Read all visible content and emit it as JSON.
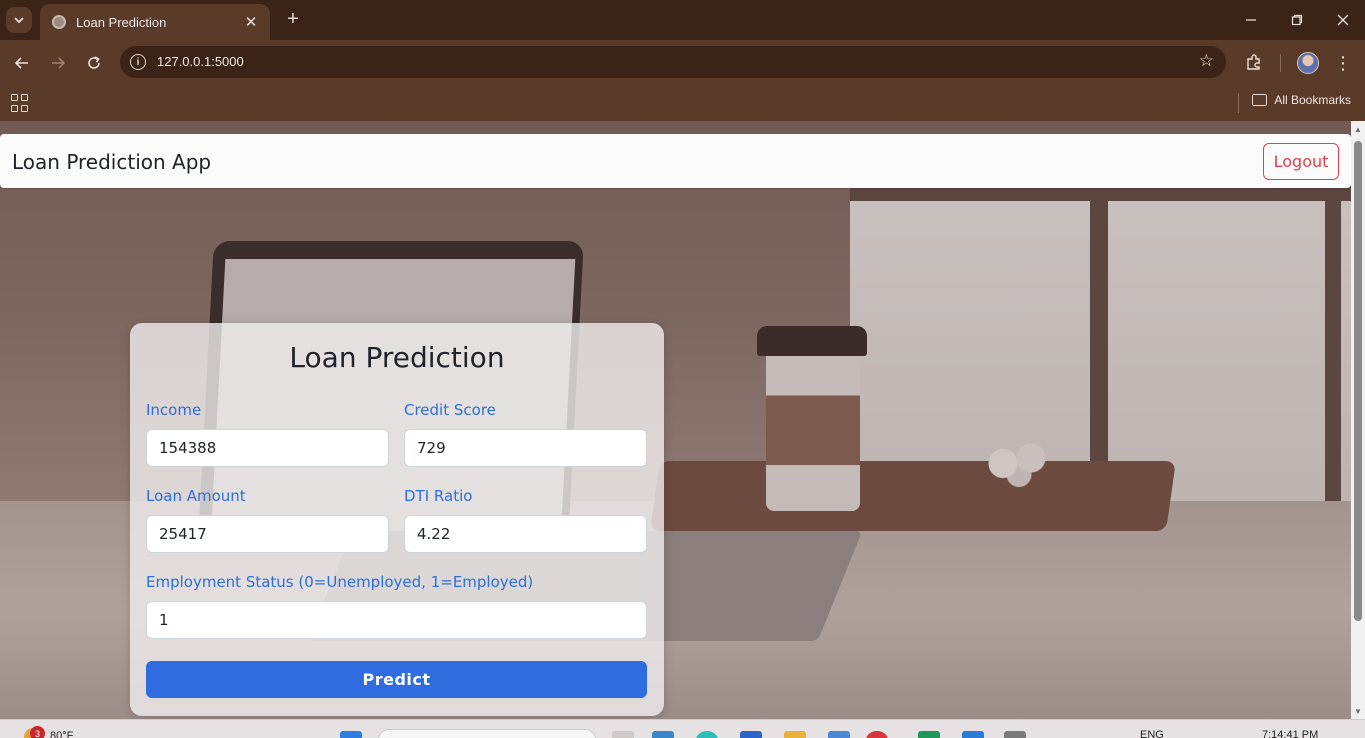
{
  "browser": {
    "tab_title": "Loan Prediction",
    "url": "127.0.0.1:5000",
    "bookmarks_label": "All Bookmarks",
    "icons": {
      "tab_list": "chevron-down-icon",
      "tab_close": "close-icon",
      "new_tab": "plus-icon",
      "back": "arrow-left-icon",
      "forward": "arrow-right-icon",
      "reload": "reload-icon",
      "site_info": "info-icon",
      "bookmark_star": "star-icon",
      "extensions": "puzzle-icon",
      "menu": "kebab-menu-icon"
    }
  },
  "app": {
    "brand": "Loan Prediction App",
    "logout_label": "Logout",
    "form": {
      "title": "Loan Prediction",
      "income": {
        "label": "Income",
        "value": "154388"
      },
      "credit_score": {
        "label": "Credit Score",
        "value": "729"
      },
      "loan_amount": {
        "label": "Loan Amount",
        "value": "25417"
      },
      "dti_ratio": {
        "label": "DTI Ratio",
        "value": "4.22"
      },
      "employment_status": {
        "label": "Employment Status (0=Unemployed, 1=Employed)",
        "value": "1"
      },
      "submit_label": "Predict"
    }
  },
  "taskbar": {
    "weather_temp": "80°F",
    "notification_count": "3",
    "language": "ENG",
    "time": "7:14:41 PM"
  },
  "colors": {
    "accent": "#2e6ce0",
    "label": "#2f6ed6",
    "danger": "#d9434f",
    "chrome": "#5a3a28"
  }
}
